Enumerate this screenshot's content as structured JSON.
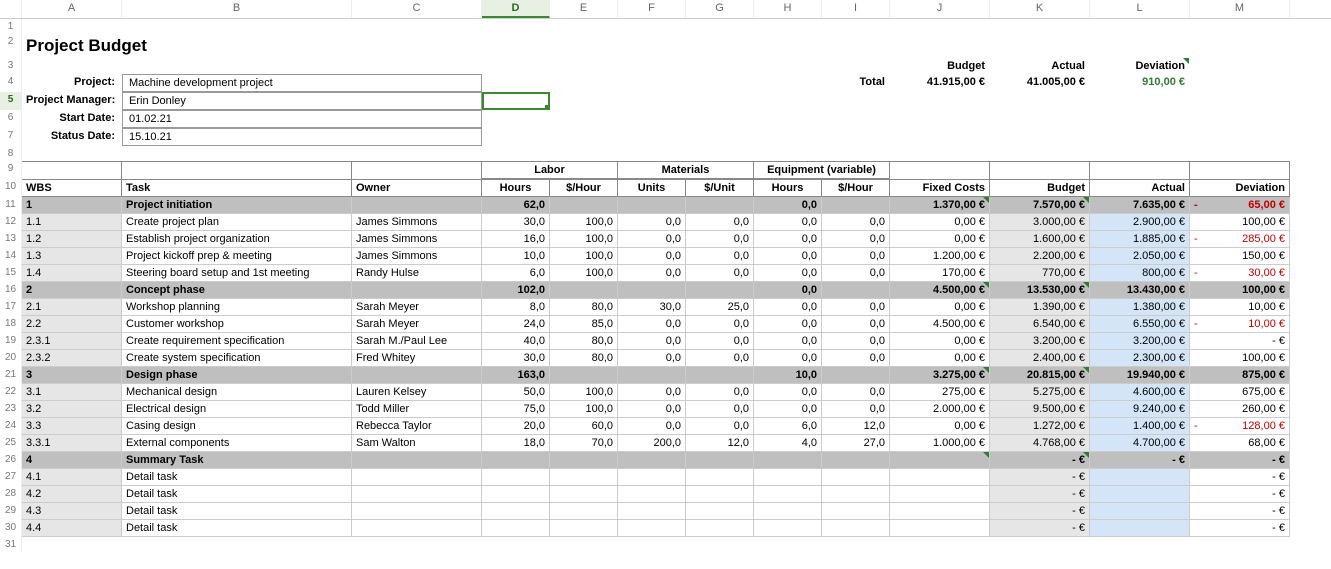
{
  "columns": [
    "",
    "A",
    "B",
    "C",
    "D",
    "E",
    "F",
    "G",
    "H",
    "I",
    "J",
    "K",
    "L",
    "M"
  ],
  "selected_col": "D",
  "title": "Project Budget",
  "info_labels": {
    "project": "Project:",
    "manager": "Project Manager:",
    "start": "Start Date:",
    "status": "Status Date:"
  },
  "info_values": {
    "project": "Machine development project",
    "manager": "Erin Donley",
    "start": "01.02.21",
    "status": "15.10.21"
  },
  "totals": {
    "label": "Total",
    "budget_hdr": "Budget",
    "budget_val": "41.915,00 €",
    "actual_hdr": "Actual",
    "actual_val": "41.005,00 €",
    "dev_hdr": "Deviation",
    "dev_val": "910,00 €"
  },
  "group_headers": {
    "labor": "Labor",
    "materials": "Materials",
    "equipment": "Equipment (variable)"
  },
  "col_headers": {
    "wbs": "WBS",
    "task": "Task",
    "owner": "Owner",
    "l_hours": "Hours",
    "l_rate": "$/Hour",
    "m_units": "Units",
    "m_rate": "$/Unit",
    "e_hours": "Hours",
    "e_rate": "$/Hour",
    "fixed": "Fixed Costs",
    "budget": "Budget",
    "actual": "Actual",
    "dev": "Deviation"
  },
  "rows": [
    {
      "rn": 11,
      "type": "sum",
      "wbs": "1",
      "task": "Project initiation",
      "owner": "",
      "lh": "62,0",
      "lr": "",
      "mu": "",
      "mr": "",
      "eh": "0,0",
      "er": "",
      "fixed": "1.370,00 €",
      "budget": "7.570,00 €",
      "actual": "7.635,00 €",
      "dev": "65,00 €",
      "dev_cls": "red",
      "dev_prefix": "-"
    },
    {
      "rn": 12,
      "type": "item",
      "wbs": "1.1",
      "task": "Create project plan",
      "owner": "James Simmons",
      "lh": "30,0",
      "lr": "100,0",
      "mu": "0,0",
      "mr": "0,0",
      "eh": "0,0",
      "er": "0,0",
      "fixed": "0,00 €",
      "budget": "3.000,00 €",
      "actual": "2.900,00 €",
      "dev": "100,00 €",
      "dev_cls": ""
    },
    {
      "rn": 13,
      "type": "item",
      "wbs": "1.2",
      "task": "Establish project organization",
      "owner": "James Simmons",
      "lh": "16,0",
      "lr": "100,0",
      "mu": "0,0",
      "mr": "0,0",
      "eh": "0,0",
      "er": "0,0",
      "fixed": "0,00 €",
      "budget": "1.600,00 €",
      "actual": "1.885,00 €",
      "dev": "285,00 €",
      "dev_cls": "red",
      "dev_prefix": "-"
    },
    {
      "rn": 14,
      "type": "item",
      "wbs": "1.3",
      "task": "Project kickoff prep & meeting",
      "owner": "James Simmons",
      "lh": "10,0",
      "lr": "100,0",
      "mu": "0,0",
      "mr": "0,0",
      "eh": "0,0",
      "er": "0,0",
      "fixed": "1.200,00 €",
      "budget": "2.200,00 €",
      "actual": "2.050,00 €",
      "dev": "150,00 €",
      "dev_cls": ""
    },
    {
      "rn": 15,
      "type": "item",
      "wbs": "1.4",
      "task": "Steering board setup and 1st meeting",
      "owner": "Randy Hulse",
      "lh": "6,0",
      "lr": "100,0",
      "mu": "0,0",
      "mr": "0,0",
      "eh": "0,0",
      "er": "0,0",
      "fixed": "170,00 €",
      "budget": "770,00 €",
      "actual": "800,00 €",
      "dev": "30,00 €",
      "dev_cls": "red",
      "dev_prefix": "-"
    },
    {
      "rn": 16,
      "type": "sum",
      "wbs": "2",
      "task": "Concept phase",
      "owner": "",
      "lh": "102,0",
      "lr": "",
      "mu": "",
      "mr": "",
      "eh": "0,0",
      "er": "",
      "fixed": "4.500,00 €",
      "budget": "13.530,00 €",
      "actual": "13.430,00 €",
      "dev": "100,00 €",
      "dev_cls": ""
    },
    {
      "rn": 17,
      "type": "item",
      "wbs": "2.1",
      "task": "Workshop planning",
      "owner": "Sarah Meyer",
      "lh": "8,0",
      "lr": "80,0",
      "mu": "30,0",
      "mr": "25,0",
      "eh": "0,0",
      "er": "0,0",
      "fixed": "0,00 €",
      "budget": "1.390,00 €",
      "actual": "1.380,00 €",
      "dev": "10,00 €",
      "dev_cls": ""
    },
    {
      "rn": 18,
      "type": "item",
      "wbs": "2.2",
      "task": "Customer workshop",
      "owner": "Sarah Meyer",
      "lh": "24,0",
      "lr": "85,0",
      "mu": "0,0",
      "mr": "0,0",
      "eh": "0,0",
      "er": "0,0",
      "fixed": "4.500,00 €",
      "budget": "6.540,00 €",
      "actual": "6.550,00 €",
      "dev": "10,00 €",
      "dev_cls": "red",
      "dev_prefix": "-"
    },
    {
      "rn": 19,
      "type": "item",
      "wbs": "2.3.1",
      "task": "Create requirement specification",
      "owner": "Sarah M./Paul Lee",
      "lh": "40,0",
      "lr": "80,0",
      "mu": "0,0",
      "mr": "0,0",
      "eh": "0,0",
      "er": "0,0",
      "fixed": "0,00 €",
      "budget": "3.200,00 €",
      "actual": "3.200,00 €",
      "dev": "-   €",
      "dev_cls": ""
    },
    {
      "rn": 20,
      "type": "item",
      "wbs": "2.3.2",
      "task": "Create system specification",
      "owner": "Fred Whitey",
      "lh": "30,0",
      "lr": "80,0",
      "mu": "0,0",
      "mr": "0,0",
      "eh": "0,0",
      "er": "0,0",
      "fixed": "0,00 €",
      "budget": "2.400,00 €",
      "actual": "2.300,00 €",
      "dev": "100,00 €",
      "dev_cls": ""
    },
    {
      "rn": 21,
      "type": "sum",
      "wbs": "3",
      "task": "Design phase",
      "owner": "",
      "lh": "163,0",
      "lr": "",
      "mu": "",
      "mr": "",
      "eh": "10,0",
      "er": "",
      "fixed": "3.275,00 €",
      "budget": "20.815,00 €",
      "actual": "19.940,00 €",
      "dev": "875,00 €",
      "dev_cls": ""
    },
    {
      "rn": 22,
      "type": "item",
      "wbs": "3.1",
      "task": "Mechanical design",
      "owner": "Lauren Kelsey",
      "lh": "50,0",
      "lr": "100,0",
      "mu": "0,0",
      "mr": "0,0",
      "eh": "0,0",
      "er": "0,0",
      "fixed": "275,00 €",
      "budget": "5.275,00 €",
      "actual": "4.600,00 €",
      "dev": "675,00 €",
      "dev_cls": ""
    },
    {
      "rn": 23,
      "type": "item",
      "wbs": "3.2",
      "task": "Electrical design",
      "owner": "Todd Miller",
      "lh": "75,0",
      "lr": "100,0",
      "mu": "0,0",
      "mr": "0,0",
      "eh": "0,0",
      "er": "0,0",
      "fixed": "2.000,00 €",
      "budget": "9.500,00 €",
      "actual": "9.240,00 €",
      "dev": "260,00 €",
      "dev_cls": ""
    },
    {
      "rn": 24,
      "type": "item",
      "wbs": "3.3",
      "task": "Casing design",
      "owner": "Rebecca Taylor",
      "lh": "20,0",
      "lr": "60,0",
      "mu": "0,0",
      "mr": "0,0",
      "eh": "6,0",
      "er": "12,0",
      "fixed": "0,00 €",
      "budget": "1.272,00 €",
      "actual": "1.400,00 €",
      "dev": "128,00 €",
      "dev_cls": "red",
      "dev_prefix": "-"
    },
    {
      "rn": 25,
      "type": "item",
      "wbs": "3.3.1",
      "task": "External components",
      "owner": "Sam Walton",
      "lh": "18,0",
      "lr": "70,0",
      "mu": "200,0",
      "mr": "12,0",
      "eh": "4,0",
      "er": "27,0",
      "fixed": "1.000,00 €",
      "budget": "4.768,00 €",
      "actual": "4.700,00 €",
      "dev": "68,00 €",
      "dev_cls": ""
    },
    {
      "rn": 26,
      "type": "sum",
      "wbs": "4",
      "task": "Summary Task",
      "owner": "",
      "lh": "",
      "lr": "",
      "mu": "",
      "mr": "",
      "eh": "",
      "er": "",
      "fixed": "",
      "budget": "-   €",
      "actual": "-   €",
      "dev": "-   €",
      "dev_cls": ""
    },
    {
      "rn": 27,
      "type": "item",
      "wbs": "4.1",
      "task": "Detail task",
      "owner": "",
      "lh": "",
      "lr": "",
      "mu": "",
      "mr": "",
      "eh": "",
      "er": "",
      "fixed": "",
      "budget": "-   €",
      "actual": "",
      "dev": "-   €",
      "dev_cls": ""
    },
    {
      "rn": 28,
      "type": "item",
      "wbs": "4.2",
      "task": "Detail task",
      "owner": "",
      "lh": "",
      "lr": "",
      "mu": "",
      "mr": "",
      "eh": "",
      "er": "",
      "fixed": "",
      "budget": "-   €",
      "actual": "",
      "dev": "-   €",
      "dev_cls": ""
    },
    {
      "rn": 29,
      "type": "item",
      "wbs": "4.3",
      "task": "Detail task",
      "owner": "",
      "lh": "",
      "lr": "",
      "mu": "",
      "mr": "",
      "eh": "",
      "er": "",
      "fixed": "",
      "budget": "-   €",
      "actual": "",
      "dev": "-   €",
      "dev_cls": ""
    },
    {
      "rn": 30,
      "type": "item",
      "wbs": "4.4",
      "task": "Detail task",
      "owner": "",
      "lh": "",
      "lr": "",
      "mu": "",
      "mr": "",
      "eh": "",
      "er": "",
      "fixed": "",
      "budget": "-   €",
      "actual": "",
      "dev": "-   €",
      "dev_cls": ""
    }
  ]
}
